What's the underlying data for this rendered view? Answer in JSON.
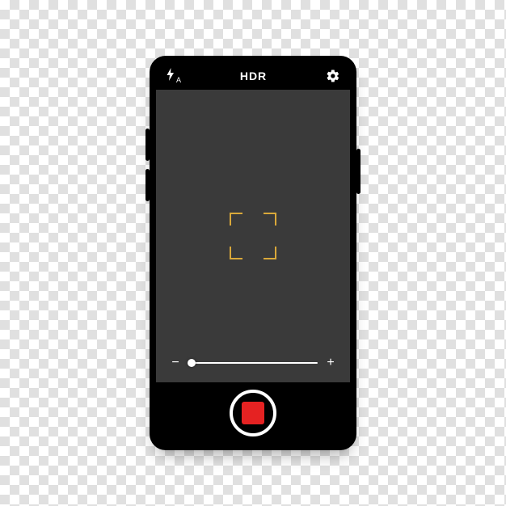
{
  "topbar": {
    "flash_mode": "A",
    "hdr_label": "HDR"
  },
  "zoom": {
    "minus": "−",
    "plus": "+"
  },
  "colors": {
    "focus_ring": "#d9a83a",
    "record": "#e52222",
    "viewfinder_bg": "#3a3a3a"
  },
  "icons": {
    "flash": "flash-auto",
    "settings": "gear"
  }
}
